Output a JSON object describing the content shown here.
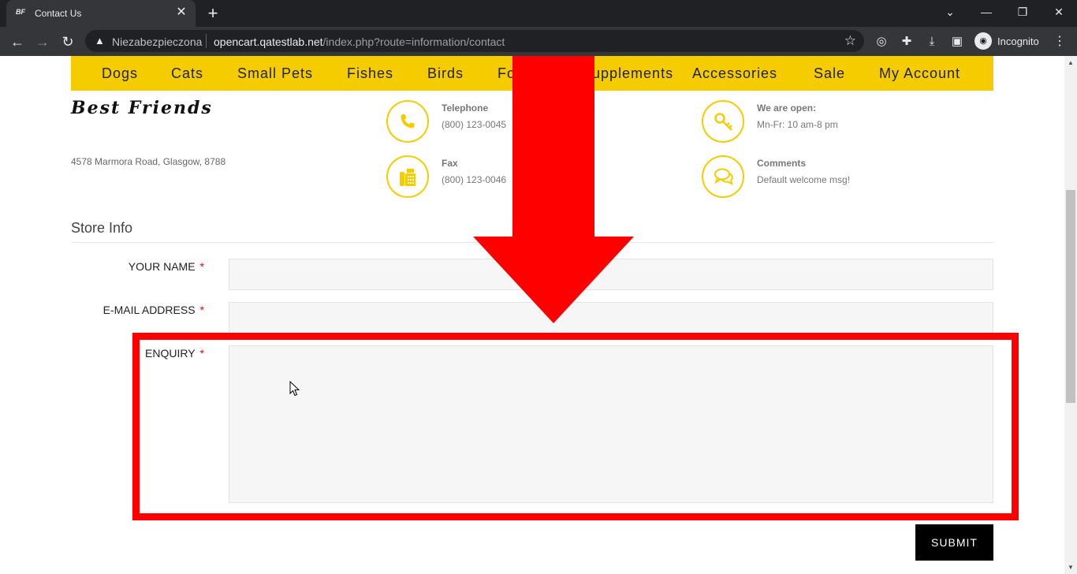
{
  "browser": {
    "tab_title": "Contact Us",
    "tab_favicon": "BF",
    "security_label": "Niezabezpieczona",
    "url_host": "opencart.qatestlab.net",
    "url_path": "/index.php?route=information/contact",
    "profile_label": "Incognito"
  },
  "nav": {
    "items": [
      "Dogs",
      "Cats",
      "Small Pets",
      "Fishes",
      "Birds",
      "Food",
      "Supplements",
      "Accessories",
      "Sale",
      "My Account"
    ]
  },
  "store": {
    "logo_text": "Best Friends",
    "address": "4578 Marmora Road, Glasgow, 8788",
    "telephone_title": "Telephone",
    "telephone_value": "(800) 123-0045",
    "fax_title": "Fax",
    "fax_value": "(800) 123-0046",
    "hours_title": "We are open:",
    "hours_value": "Mn-Fr: 10 am-8 pm",
    "comments_title": "Comments",
    "comments_value": "Default welcome msg!"
  },
  "form": {
    "section_title": "Store Info",
    "name_label": "YOUR NAME",
    "email_label": "E-MAIL ADDRESS",
    "enquiry_label": "ENQUIRY",
    "required_marker": "*",
    "submit_label": "SUBMIT"
  },
  "annotation": {
    "color": "#ff0000"
  },
  "colors": {
    "accent": "#f5cc00",
    "chrome_dark": "#202124"
  }
}
